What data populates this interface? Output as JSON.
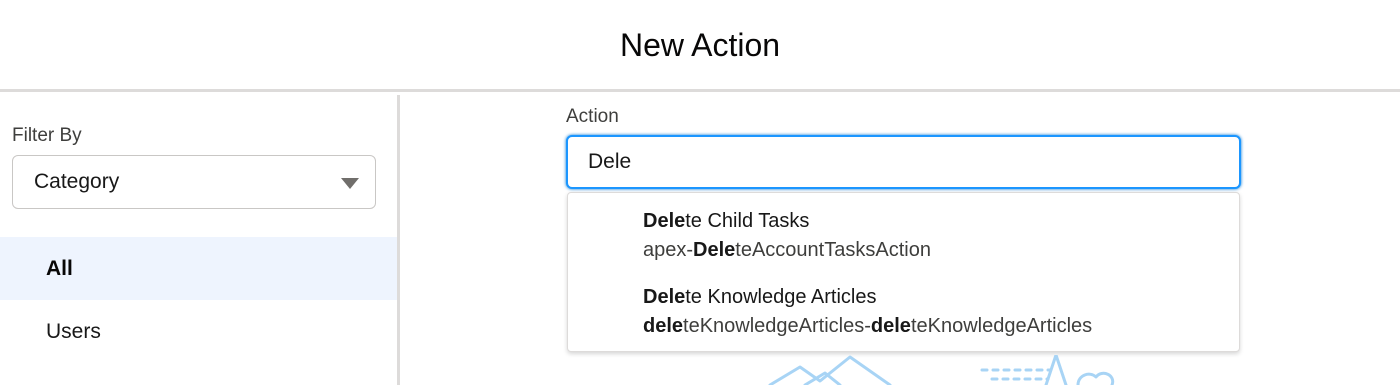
{
  "header": {
    "title": "New Action"
  },
  "sidebar": {
    "filter_label": "Filter By",
    "filter_select": {
      "value": "Category"
    },
    "items": [
      {
        "label": "All",
        "selected": true
      },
      {
        "label": "Users",
        "selected": false
      }
    ]
  },
  "main": {
    "action_label": "Action",
    "action_input": {
      "value": "Dele"
    },
    "suggestions": [
      {
        "line1_match": "Dele",
        "line1_rest": "te Child Tasks",
        "line2_prefix": "apex-",
        "line2_match": "Dele",
        "line2_rest": "teAccountTasksAction"
      },
      {
        "line1_match": "Dele",
        "line1_rest": "te Knowledge Articles",
        "line2_match": "dele",
        "line2_mid": "teKnowledgeArticles-",
        "line2_match2": "dele",
        "line2_rest": "teKnowledgeArticles"
      }
    ]
  },
  "colors": {
    "focus_border": "#1b96ff",
    "selected_bg": "#eef4fe",
    "divider": "#dddbda",
    "illustration": "#a8d4f5"
  }
}
